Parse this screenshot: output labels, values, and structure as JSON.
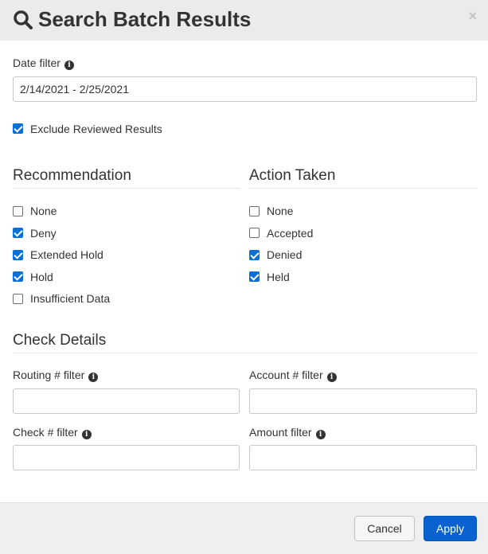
{
  "modal": {
    "title": "Search Batch Results",
    "close_label": "×",
    "icon": "search-icon"
  },
  "date_filter": {
    "label": "Date filter",
    "value": "2/14/2021 - 2/25/2021",
    "info_icon": "info-icon"
  },
  "exclude_reviewed": {
    "label": "Exclude Reviewed Results",
    "checked": true
  },
  "recommendation": {
    "title": "Recommendation",
    "options": [
      {
        "label": "None",
        "checked": false
      },
      {
        "label": "Deny",
        "checked": true
      },
      {
        "label": "Extended Hold",
        "checked": true
      },
      {
        "label": "Hold",
        "checked": true
      },
      {
        "label": "Insufficient Data",
        "checked": false
      }
    ]
  },
  "action_taken": {
    "title": "Action Taken",
    "options": [
      {
        "label": "None",
        "checked": false
      },
      {
        "label": "Accepted",
        "checked": false
      },
      {
        "label": "Denied",
        "checked": true
      },
      {
        "label": "Held",
        "checked": true
      }
    ]
  },
  "check_details": {
    "title": "Check Details",
    "routing_label": "Routing # filter",
    "routing_value": "",
    "account_label": "Account # filter",
    "account_value": "",
    "check_label": "Check # filter",
    "check_value": "",
    "amount_label": "Amount filter",
    "amount_value": ""
  },
  "footer": {
    "cancel_label": "Cancel",
    "apply_label": "Apply"
  },
  "colors": {
    "accent": "#0b6fd8",
    "header_bg": "#ebebeb",
    "footer_bg": "#efefef"
  }
}
